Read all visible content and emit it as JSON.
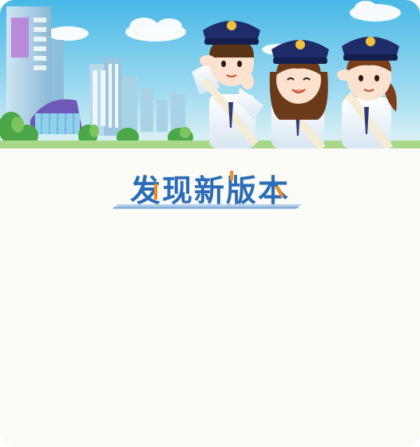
{
  "dialog": {
    "title": "发现新版本"
  },
  "colors": {
    "title_blue": "#2b6cb8",
    "title_accent": "#f08a1c",
    "background": "#fcfbf7",
    "sky_top": "#5cc3ea",
    "sky_bottom": "#d7f0f7"
  },
  "banner": {
    "subject": "police-officers-illustration"
  }
}
